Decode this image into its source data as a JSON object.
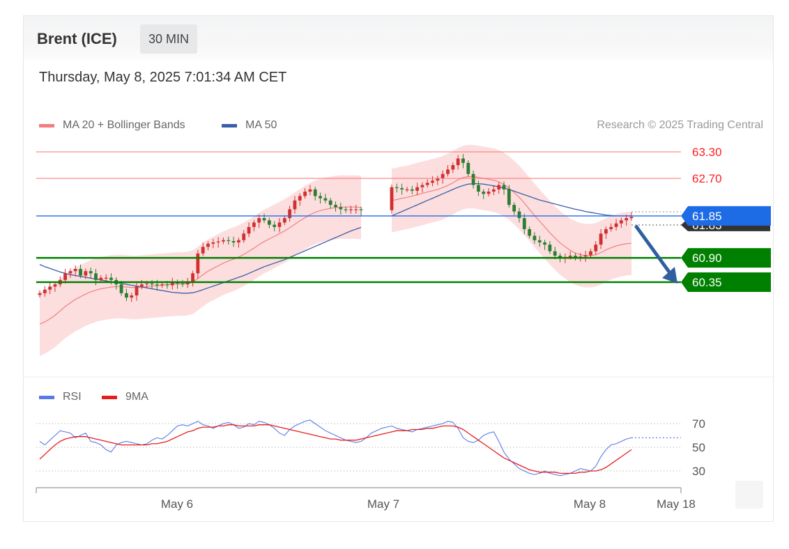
{
  "header": {
    "instrument": "Brent (ICE)",
    "timeframe": "30 MIN",
    "datetime": "Thursday, May 8, 2025 7:01:34 AM CET",
    "credit": "Research © 2025 Trading Central"
  },
  "legend": {
    "ma20": "MA 20 + Bollinger Bands",
    "ma50": "MA 50",
    "rsi": "RSI",
    "rsi_ma": "9MA"
  },
  "colors": {
    "bull": "#d32f2f",
    "bear": "#2e7d32",
    "ma20": "#f08080",
    "ma50": "#3a5fa8",
    "band_fill": "#fbd3d3",
    "resistance": "#ff7070",
    "pivot": "#1e6be6",
    "support": "#008000",
    "forecast_arrow": "#2f5f9f",
    "rsi": "#5a79e6",
    "rsi_ma": "#e81c1c"
  },
  "chart_data": [
    {
      "type": "candlestick",
      "title": "Brent (ICE) 30 MIN",
      "ylim": [
        58.55,
        63.5
      ],
      "x_ticks": [
        "May 6",
        "May 7",
        "May 8",
        "May 18"
      ],
      "levels": [
        {
          "value": 63.3,
          "label": "63.30",
          "kind": "resistance"
        },
        {
          "value": 62.7,
          "label": "62.70",
          "kind": "resistance"
        },
        {
          "value": 61.85,
          "label": "61.85",
          "kind": "pivot"
        },
        {
          "value": 61.83,
          "label": "61.83",
          "kind": "last"
        },
        {
          "value": 60.9,
          "label": "60.90",
          "kind": "support"
        },
        {
          "value": 60.35,
          "label": "60.35",
          "kind": "support"
        }
      ],
      "forecast": {
        "from_value": 61.85,
        "to_value": 60.35,
        "direction": "down"
      },
      "series": [
        {
          "name": "Price",
          "close": [
            60.1,
            60.18,
            60.25,
            60.3,
            60.4,
            60.55,
            60.6,
            60.65,
            60.5,
            60.6,
            60.55,
            60.4,
            60.45,
            60.45,
            60.4,
            60.3,
            60.1,
            60.0,
            60.05,
            60.25,
            60.3,
            60.32,
            60.3,
            60.28,
            60.3,
            60.28,
            60.35,
            60.32,
            60.3,
            60.35,
            60.55,
            61.0,
            61.15,
            61.22,
            61.25,
            61.27,
            61.3,
            61.28,
            61.25,
            61.3,
            61.45,
            61.6,
            61.7,
            61.8,
            61.75,
            61.65,
            61.6,
            61.7,
            61.8,
            62.0,
            62.2,
            62.3,
            62.4,
            62.45,
            62.3,
            62.25,
            62.2,
            62.1,
            62.05,
            62.0,
            61.98,
            62.0,
            62.0,
            61.98,
            null,
            null,
            null,
            null,
            null,
            62.5,
            62.48,
            62.45,
            62.45,
            62.42,
            62.5,
            62.55,
            62.6,
            62.65,
            62.7,
            62.8,
            62.9,
            63.0,
            63.15,
            63.05,
            62.8,
            62.55,
            62.4,
            62.35,
            62.4,
            62.45,
            62.55,
            62.45,
            62.1,
            61.95,
            61.8,
            61.55,
            61.4,
            61.3,
            61.25,
            61.2,
            61.05,
            60.95,
            60.9,
            60.92,
            60.95,
            60.92,
            60.93,
            60.96,
            61.05,
            61.2,
            61.45,
            61.55,
            61.6,
            61.68,
            61.75,
            61.8,
            61.83
          ]
        },
        {
          "name": "MA 20",
          "values": [
            59.4,
            59.45,
            59.52,
            59.6,
            59.7,
            59.8,
            59.88,
            59.96,
            60.02,
            60.08,
            60.13,
            60.17,
            60.2,
            60.22,
            60.24,
            60.25,
            60.25,
            60.24,
            60.23,
            60.23,
            60.24,
            60.25,
            60.26,
            60.27,
            60.28,
            60.29,
            60.3,
            60.31,
            60.31,
            60.32,
            60.35,
            60.43,
            60.52,
            60.6,
            60.66,
            60.72,
            60.78,
            60.83,
            60.87,
            60.92,
            60.98,
            61.05,
            61.12,
            61.2,
            61.27,
            61.33,
            61.39,
            61.45,
            61.51,
            61.58,
            61.66,
            61.74,
            61.81,
            61.88,
            61.93,
            61.97,
            62.0,
            62.02,
            62.04,
            62.05,
            62.05,
            62.05,
            62.05,
            62.04,
            null,
            null,
            null,
            null,
            null,
            62.2,
            62.22,
            62.25,
            62.27,
            62.3,
            62.33,
            62.36,
            62.39,
            62.42,
            62.45,
            62.49,
            62.54,
            62.6,
            62.67,
            62.72,
            62.74,
            62.74,
            62.72,
            62.7,
            62.68,
            62.66,
            62.62,
            62.56,
            62.48,
            62.38,
            62.27,
            62.14,
            62.0,
            61.86,
            61.73,
            61.6,
            61.47,
            61.35,
            61.24,
            61.15,
            61.07,
            61.01,
            60.97,
            60.95,
            60.95,
            60.97,
            61.02,
            61.08,
            61.13,
            61.17,
            61.2,
            61.22,
            61.23
          ]
        },
        {
          "name": "MA 50",
          "values": [
            60.75,
            60.7,
            60.66,
            60.62,
            60.58,
            60.55,
            60.52,
            60.5,
            60.48,
            60.46,
            60.44,
            60.42,
            60.4,
            60.38,
            60.36,
            60.34,
            60.32,
            60.3,
            60.28,
            60.26,
            60.24,
            60.22,
            60.2,
            60.18,
            60.16,
            60.14,
            60.12,
            60.11,
            60.1,
            60.1,
            60.11,
            60.14,
            60.18,
            60.22,
            60.26,
            60.3,
            60.34,
            60.38,
            60.42,
            60.46,
            60.5,
            60.55,
            60.6,
            60.65,
            60.7,
            60.74,
            60.78,
            60.82,
            60.86,
            60.91,
            60.96,
            61.01,
            61.06,
            61.11,
            61.16,
            61.21,
            61.26,
            61.31,
            61.36,
            61.41,
            61.46,
            61.51,
            61.55,
            61.59,
            null,
            null,
            null,
            null,
            null,
            61.85,
            61.9,
            61.95,
            62.0,
            62.05,
            62.1,
            62.15,
            62.2,
            62.25,
            62.3,
            62.35,
            62.4,
            62.45,
            62.5,
            62.54,
            62.57,
            62.58,
            62.58,
            62.57,
            62.55,
            62.53,
            62.51,
            62.48,
            62.45,
            62.41,
            62.37,
            62.33,
            62.29,
            62.25,
            62.21,
            62.18,
            62.15,
            62.12,
            62.09,
            62.06,
            62.03,
            62.0,
            61.98,
            61.95,
            61.93,
            61.91,
            61.89,
            61.87,
            61.86,
            61.85,
            61.85,
            61.85,
            61.85
          ]
        }
      ]
    },
    {
      "type": "line",
      "title": "RSI",
      "ylim": [
        20,
        80
      ],
      "y_ticks": [
        70,
        50,
        30
      ],
      "series": [
        {
          "name": "RSI",
          "values": [
            55,
            52,
            56,
            60,
            64,
            63,
            62,
            58,
            60,
            62,
            55,
            54,
            52,
            48,
            46,
            52,
            54,
            55,
            54,
            53,
            52,
            53,
            56,
            58,
            57,
            60,
            64,
            68,
            69,
            68,
            70,
            72,
            69,
            68,
            66,
            68,
            70,
            71,
            69,
            66,
            67,
            70,
            69,
            72,
            71,
            69,
            66,
            62,
            60,
            65,
            68,
            70,
            72,
            73,
            70,
            67,
            64,
            62,
            60,
            58,
            56,
            55,
            54,
            55,
            58,
            62,
            64,
            66,
            67,
            68,
            66,
            65,
            64,
            63,
            65,
            66,
            67,
            68,
            69,
            70,
            72,
            71,
            66,
            58,
            55,
            54,
            56,
            60,
            62,
            63,
            55,
            46,
            40,
            36,
            32,
            30,
            28,
            27,
            28,
            30,
            28,
            27,
            26,
            27,
            28,
            30,
            32,
            31,
            30,
            34,
            42,
            48,
            52,
            53,
            55,
            57,
            58
          ]
        },
        {
          "name": "9MA",
          "values": [
            40,
            44,
            48,
            52,
            55,
            57,
            58,
            59,
            59,
            59,
            58,
            57,
            56,
            55,
            54,
            53,
            52,
            52,
            52,
            52,
            52,
            52,
            53,
            53,
            54,
            55,
            57,
            59,
            61,
            63,
            64,
            66,
            67,
            67,
            67,
            68,
            68,
            69,
            69,
            68,
            68,
            68,
            68,
            69,
            69,
            69,
            68,
            67,
            66,
            65,
            64,
            63,
            62,
            61,
            60,
            59,
            58,
            57,
            57,
            56,
            56,
            56,
            56,
            57,
            58,
            59,
            60,
            61,
            62,
            63,
            64,
            64,
            64,
            65,
            65,
            65,
            66,
            66,
            67,
            68,
            68,
            68,
            67,
            65,
            62,
            59,
            56,
            53,
            50,
            47,
            44,
            41,
            39,
            37,
            35,
            33,
            31,
            30,
            29,
            29,
            29,
            29,
            28,
            28,
            28,
            28,
            29,
            29,
            30,
            30,
            31,
            33,
            36,
            39,
            42,
            45,
            48
          ]
        }
      ]
    }
  ]
}
